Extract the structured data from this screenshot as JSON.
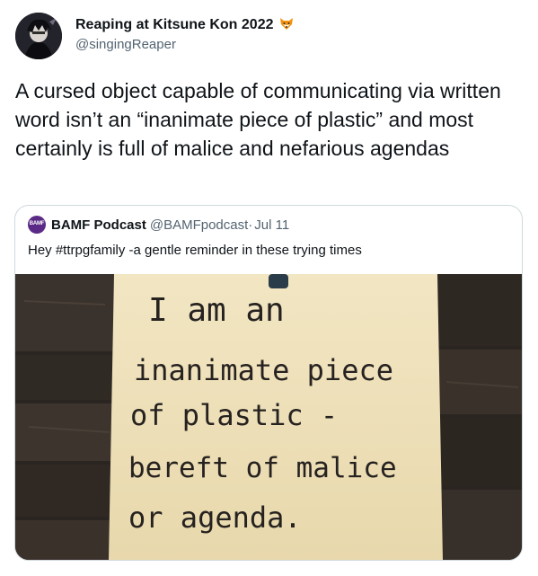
{
  "tweet": {
    "display_name": "Reaping at Kitsune Kon 2022",
    "name_emoji": "fox-face-icon",
    "handle": "@singingReaper",
    "text": "A cursed object capable of communicating via written word isn’t an “inanimate piece of plastic” and most certainly is full of malice and nefarious agendas"
  },
  "quoted_tweet": {
    "display_name": "BAMF Podcast",
    "handle": "@BAMFpodcast",
    "separator": "·",
    "date": "Jul 11",
    "avatar_text": "BAMF",
    "text": "Hey #ttrpgfamily -a gentle reminder in these trying times",
    "image": {
      "description_icon": "handwritten-note-photo",
      "lines": [
        "I am an",
        "inanimate piece",
        "of plastic -",
        "bereft of malice",
        "or agenda."
      ]
    }
  },
  "colors": {
    "text_primary": "#0f1419",
    "text_secondary": "#536471",
    "border": "#cfd9de",
    "paper": "#efe2bd",
    "wood": "#2b2521"
  }
}
